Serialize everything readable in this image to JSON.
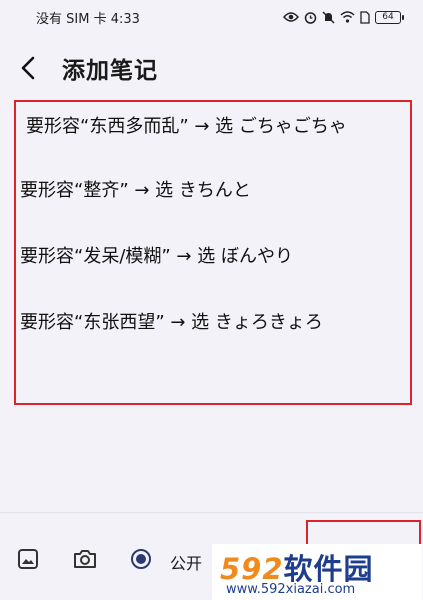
{
  "status_bar": {
    "carrier_time": "没有 SIM 卡 4:33",
    "battery": "64",
    "icons": [
      "eye-icon",
      "alarm-icon",
      "mute-bell-icon",
      "wifi-icon",
      "sim-icon",
      "battery-icon"
    ]
  },
  "header": {
    "back_icon": "chevron-left-icon",
    "title": "添加笔记"
  },
  "note": {
    "lines": [
      "要形容“东西多而乱” → 选 ごちゃごちゃ",
      "要形容“整齐” → 选 きちんと",
      "要形容“发呆/模糊” → 选 ぼんやり",
      "要形容“东张西望” → 选 きょろきょろ"
    ]
  },
  "toolbar": {
    "items": [
      "image-icon",
      "camera-icon",
      "radio-icon"
    ],
    "public_label": "公开"
  },
  "watermark": {
    "number": "592",
    "text": "软件园",
    "url": "www.592xiazai.com"
  },
  "colors": {
    "annotation_red": "#d9262a",
    "background": "#f3f2f8",
    "watermark_blue": "#1e3d8f",
    "watermark_orange": "#f08a1c"
  }
}
